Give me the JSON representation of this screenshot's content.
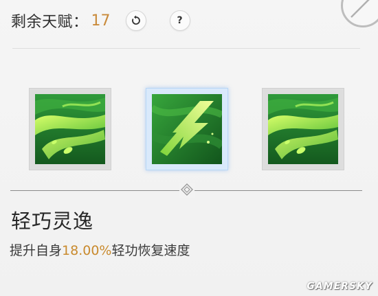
{
  "header": {
    "remaining_label": "剩余天赋：",
    "remaining_value": "17",
    "reset_icon": "reset-icon",
    "help_label": "?"
  },
  "skills": [
    {
      "icon": "wind-leaf-icon",
      "selected": false
    },
    {
      "icon": "lightning-arrow-icon",
      "selected": true
    },
    {
      "icon": "wind-leaf-icon",
      "selected": false
    }
  ],
  "detail": {
    "name": "轻巧灵逸",
    "desc_prefix": "提升自身",
    "desc_value": "18.00%",
    "desc_suffix": "轻功恢复速度"
  },
  "watermark": "GAMERSKY",
  "colors": {
    "accent": "#c98a3a",
    "selected_frame": "#d9e9fb",
    "icon_green_dark": "#1f7a2a",
    "icon_green_light": "#b8f04a"
  }
}
